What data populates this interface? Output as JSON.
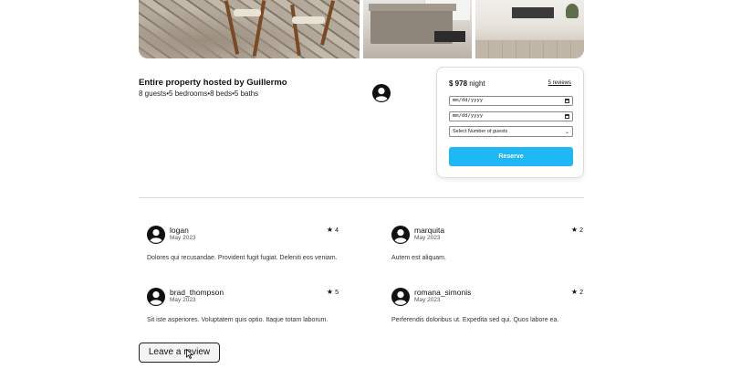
{
  "photos": [
    {
      "name": "patio-photo"
    },
    {
      "name": "kitchen-photo"
    },
    {
      "name": "living-room-photo"
    }
  ],
  "listing": {
    "title": "Entire property hosted by Guillermo",
    "details": "8 guests•5 bedrooms•8 beds•5 baths"
  },
  "booking": {
    "price": "$ 978",
    "price_unit": "night",
    "reviews_link": "5 reviews",
    "check_in_value": "mm/dd/yyyy",
    "check_out_value": "mm/dd/yyyy",
    "guests_selected": "Select Number of guests",
    "reserve_label": "Reserve"
  },
  "reviews": [
    {
      "user": "logan",
      "date": "May 2023",
      "rating": "4",
      "text": "Dolores qui recusandae. Provident fugit fugiat. Deleniti eos veniam."
    },
    {
      "user": "marquita",
      "date": "May 2023",
      "rating": "2",
      "text": "Autem est aliquam."
    },
    {
      "user": "brad_thompson",
      "date": "May 2023",
      "rating": "5",
      "text": "Sit iste asperiores. Voluptatem quis optio. Itaque totam laborum."
    },
    {
      "user": "romana_simonis",
      "date": "May 2023",
      "rating": "2",
      "text": "Perferendis doloribus ut. Expedita sed qui. Quos labore ea."
    }
  ],
  "leave_review_label": "Leave a review",
  "colors": {
    "accent": "#20b7f5",
    "divider": "#d9d9d9"
  }
}
